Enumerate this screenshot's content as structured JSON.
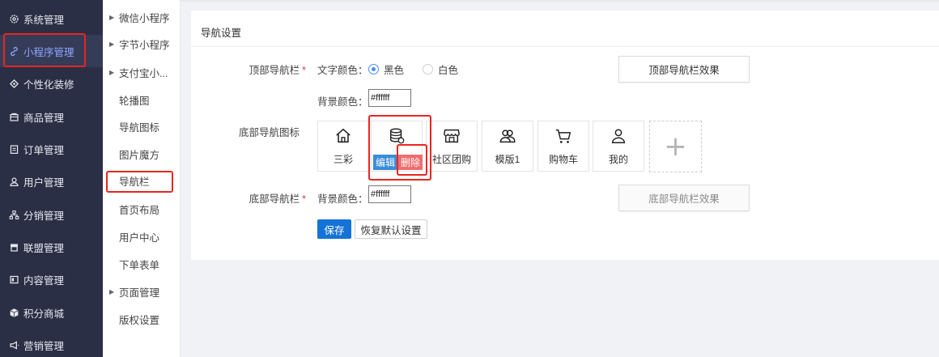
{
  "sidebar": {
    "items": [
      {
        "label": "系统管理",
        "icon": "gear-icon"
      },
      {
        "label": "小程序管理",
        "icon": "link-icon"
      },
      {
        "label": "个性化装修",
        "icon": "nodes-icon"
      },
      {
        "label": "商品管理",
        "icon": "shop-icon"
      },
      {
        "label": "订单管理",
        "icon": "clipboard-icon"
      },
      {
        "label": "用户管理",
        "icon": "user-icon"
      },
      {
        "label": "分销管理",
        "icon": "hierarchy-icon"
      },
      {
        "label": "联盟管理",
        "icon": "store-icon"
      },
      {
        "label": "内容管理",
        "icon": "content-icon"
      },
      {
        "label": "积分商城",
        "icon": "cube-icon"
      },
      {
        "label": "营销管理",
        "icon": "megaphone-icon"
      }
    ],
    "active_index": 1
  },
  "submenu": {
    "items": [
      {
        "label": "微信小程序",
        "arrow": true
      },
      {
        "label": "字节小程序",
        "arrow": true
      },
      {
        "label": "支付宝小...",
        "arrow": true
      },
      {
        "label": "轮播图",
        "arrow": false
      },
      {
        "label": "导航图标",
        "arrow": false
      },
      {
        "label": "图片魔方",
        "arrow": false
      },
      {
        "label": "导航栏",
        "arrow": false
      },
      {
        "label": "首页布局",
        "arrow": false
      },
      {
        "label": "用户中心",
        "arrow": false
      },
      {
        "label": "下单表单",
        "arrow": false
      },
      {
        "label": "页面管理",
        "arrow": true
      },
      {
        "label": "版权设置",
        "arrow": false
      }
    ],
    "active_index": 6
  },
  "content": {
    "title": "导航设置",
    "top_nav": {
      "label": "顶部导航栏",
      "text_color_label": "文字颜色：",
      "options": [
        "黑色",
        "白色"
      ],
      "selected": "黑色",
      "bg_color_label": "背景颜色：",
      "bg_color_value": "#ffffff",
      "effect_button": "顶部导航栏效果"
    },
    "bottom_icons": {
      "label": "底部导航图标",
      "items": [
        {
          "label": "三彩",
          "icon": "home-icon"
        },
        {
          "label": "",
          "icon": "database-icon"
        },
        {
          "label": "社区团购",
          "icon": "store-icon"
        },
        {
          "label": "模版1",
          "icon": "users-icon"
        },
        {
          "label": "购物车",
          "icon": "cart-icon"
        },
        {
          "label": "我的",
          "icon": "user-icon"
        }
      ],
      "edit_label": "编辑",
      "delete_label": "删除",
      "add_symbol": "+"
    },
    "bottom_nav": {
      "label": "底部导航栏",
      "bg_color_label": "背景颜色：",
      "bg_color_value": "#ffffff",
      "effect_button": "底部导航栏效果"
    },
    "save_label": "保存",
    "reset_label": "恢复默认设置"
  },
  "colors": {
    "sidebar_bg": "#2a2f45",
    "active_text": "#8ea6ff",
    "highlight_red": "#e8261f",
    "primary_blue": "#1473d6",
    "delete_red": "#ee6e6e"
  }
}
